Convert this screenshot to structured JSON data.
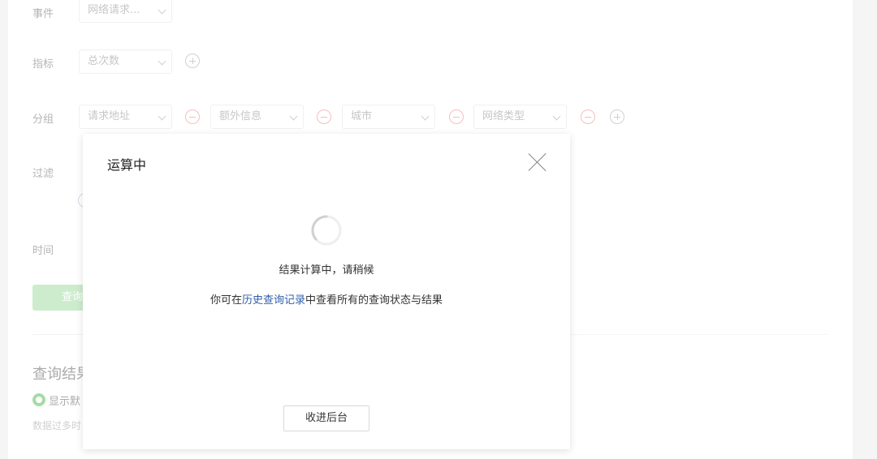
{
  "form": {
    "event": {
      "label": "事件",
      "value": "网络请求..."
    },
    "metric": {
      "label": "指标",
      "value": "总次数"
    },
    "group": {
      "label": "分组",
      "items": [
        "请求地址",
        "额外信息",
        "城市",
        "网络类型"
      ]
    },
    "filter": {
      "label": "过滤"
    },
    "time": {
      "label": "时间"
    },
    "query_button": "查询"
  },
  "results": {
    "title": "查询结果",
    "radio_label": "显示默",
    "hint": "数据过多时"
  },
  "modal": {
    "title": "运算中",
    "status": "结果计算中，请稍候",
    "history_prefix": "你可在",
    "history_link": "历史查询记录",
    "history_suffix": "中查看所有的查询状态与结果",
    "background_button": "收进后台"
  },
  "colors": {
    "accent_green": "#5cc05c",
    "link_blue": "#2f5ea8",
    "remove_red": "#f08a8a"
  }
}
